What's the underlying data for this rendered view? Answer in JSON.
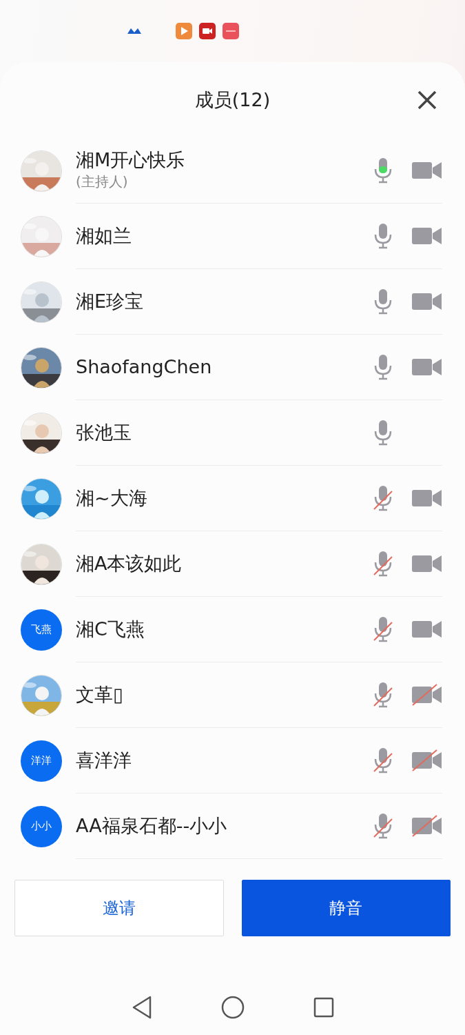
{
  "title": "成员(12)",
  "members": [
    {
      "name": "湘M开心快乐",
      "role": "(主持人)",
      "mic": {
        "muted": false,
        "speaking": true
      },
      "camera": {
        "blocked": false
      }
    },
    {
      "name": "湘如兰",
      "mic": {
        "muted": false,
        "speaking": false
      },
      "camera": {
        "blocked": false
      }
    },
    {
      "name": "湘E珍宝",
      "mic": {
        "muted": false,
        "speaking": false
      },
      "camera": {
        "blocked": false
      }
    },
    {
      "name": "ShaofangChen",
      "mic": {
        "muted": false,
        "speaking": false
      },
      "camera": {
        "blocked": false
      }
    },
    {
      "name": "张池玉",
      "mic": {
        "muted": false,
        "speaking": false
      }
    },
    {
      "name": "湘~大海",
      "mic": {
        "muted": true,
        "speaking": false
      },
      "camera": {
        "blocked": false
      }
    },
    {
      "name": "湘A本该如此",
      "mic": {
        "muted": true,
        "speaking": false
      },
      "camera": {
        "blocked": false
      }
    },
    {
      "name": "湘C飞燕",
      "avatar": {
        "kind": "initials",
        "text": "飞燕"
      },
      "mic": {
        "muted": true,
        "speaking": false
      },
      "camera": {
        "blocked": false
      }
    },
    {
      "name": "文革▯",
      "mic": {
        "muted": true,
        "speaking": false
      },
      "camera": {
        "blocked": true
      }
    },
    {
      "name": "喜洋洋",
      "avatar": {
        "kind": "initials",
        "text": "洋洋"
      },
      "mic": {
        "muted": true,
        "speaking": false
      },
      "camera": {
        "blocked": true
      }
    },
    {
      "name": "AA福泉石都--小小",
      "avatar": {
        "kind": "initials",
        "text": "小小"
      },
      "mic": {
        "muted": true,
        "speaking": false
      },
      "camera": {
        "blocked": true
      }
    }
  ],
  "buttons": [
    {
      "label": "邀请",
      "kind": "secondary"
    },
    {
      "label": "静音",
      "kind": "primary"
    }
  ]
}
